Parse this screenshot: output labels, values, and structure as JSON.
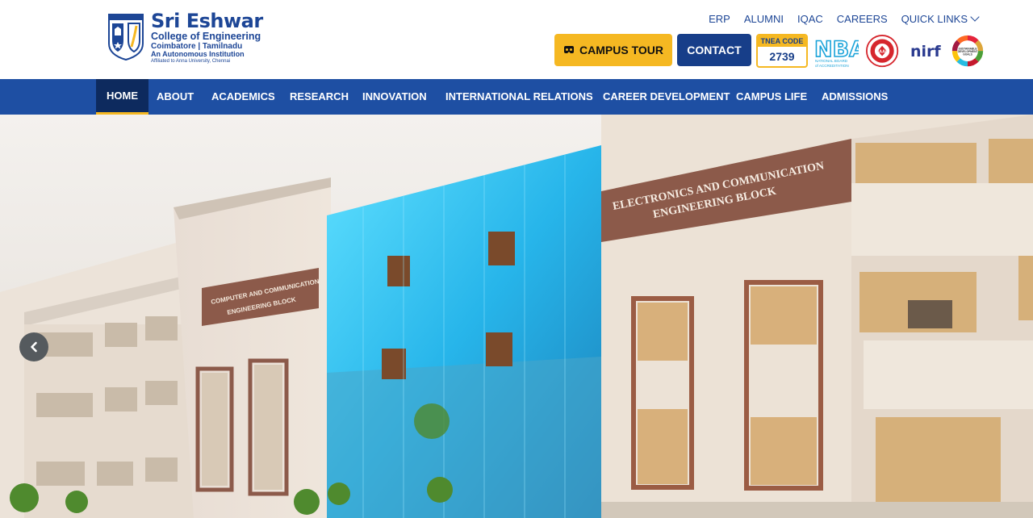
{
  "brand": {
    "name": "Sri Eshwar",
    "line1": "College of Engineering",
    "line2": "Coimbatore | Tamilnadu",
    "line3": "An Autonomous Institution",
    "line4": "Affiliated to Anna University, Chennai",
    "shield_text": "Leadership & Excellence"
  },
  "top_links": [
    "ERP",
    "ALUMNI",
    "IQAC",
    "CAREERS"
  ],
  "quick_links_label": "QUICK LINKS",
  "buttons": {
    "campus_tour": "CAMPUS TOUR",
    "contact": "CONTACT"
  },
  "tnea": {
    "label": "TNEA CODE",
    "code": "2739"
  },
  "badges": {
    "nba": "NBA",
    "nba_sub": "NATIONAL BOARD of ACCREDITATION",
    "naac": "NAAC",
    "nirf": "nirf",
    "sdg": "SUSTAINABLE DEVELOPMENT GOALS"
  },
  "nav": [
    "HOME",
    "ABOUT",
    "ACADEMICS",
    "RESEARCH",
    "INNOVATION",
    "INTERNATIONAL RELATIONS",
    "CAREER DEVELOPMENT",
    "CAMPUS LIFE",
    "ADMISSIONS"
  ],
  "hero": {
    "sign_left_1": "COMPUTER AND COMMUNICATION",
    "sign_left_2": "ENGINEERING BLOCK",
    "sign_right_1": "ELECTRONICS AND COMMUNICATION",
    "sign_right_2": "ENGINEERING BLOCK"
  },
  "colors": {
    "primary": "#1e4fa3",
    "dark": "#173e89",
    "accent": "#f5b822"
  }
}
